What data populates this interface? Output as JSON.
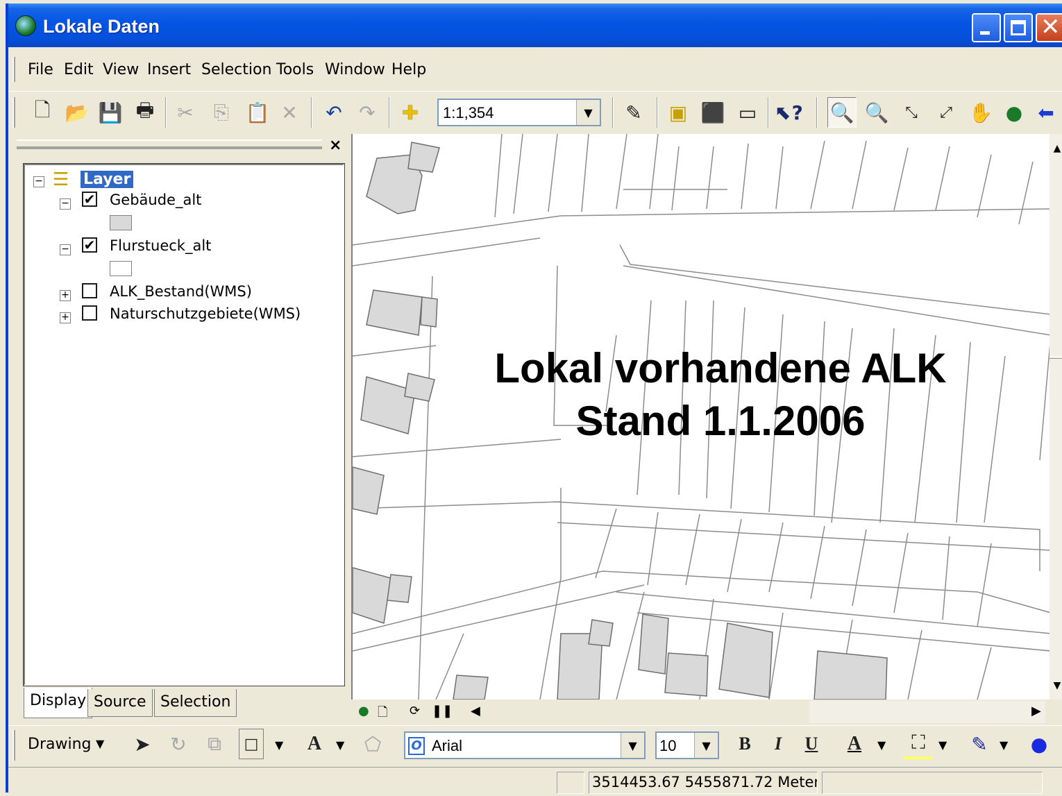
{
  "window": {
    "title": "Lokale Daten",
    "controls": [
      "minimize",
      "maximize",
      "close"
    ]
  },
  "menu": [
    "File",
    "Edit",
    "View",
    "Insert",
    "Selection",
    "Tools",
    "Window",
    "Help"
  ],
  "toolbar": {
    "scale": "1:1,354",
    "icons": [
      "new-icon",
      "open-icon",
      "save-icon",
      "print-icon",
      "cut-icon",
      "copy-icon",
      "paste-icon",
      "delete-icon",
      "undo-icon",
      "redo-icon",
      "add-data-icon",
      "editor-icon",
      "arctoolbox-icon",
      "arccatalog-icon",
      "command-window-icon",
      "whats-this-icon",
      "zoom-in-icon",
      "zoom-out-icon",
      "fixed-zoom-in-icon",
      "fixed-zoom-out-icon",
      "pan-icon",
      "full-extent-icon",
      "back-icon"
    ]
  },
  "toc": {
    "root": "Layer",
    "layers": [
      {
        "name": "Gebäude_alt",
        "checked": true,
        "expanded": true,
        "swatch": "#d9d9d9"
      },
      {
        "name": "Flurstueck_alt",
        "checked": true,
        "expanded": true,
        "swatch": "#ffffff"
      },
      {
        "name": "ALK_Bestand(WMS)",
        "checked": false,
        "expanded": false
      },
      {
        "name": "Naturschutzgebiete(WMS)",
        "checked": false,
        "expanded": false
      }
    ],
    "tabs": [
      "Display",
      "Source",
      "Selection"
    ],
    "active_tab": "Display"
  },
  "map": {
    "title_line1": "Lokal vorhandene ALK",
    "title_line2": "Stand 1.1.2006",
    "building_fill": "#d9d9d9",
    "line_color": "#8c8c8c"
  },
  "drawing_toolbar": {
    "label": "Drawing",
    "font": "Arial",
    "size": "10",
    "bold": "B",
    "italic": "I",
    "underline": "U"
  },
  "status": {
    "coordinates": "3514453.67  5455871.72 Meter"
  }
}
